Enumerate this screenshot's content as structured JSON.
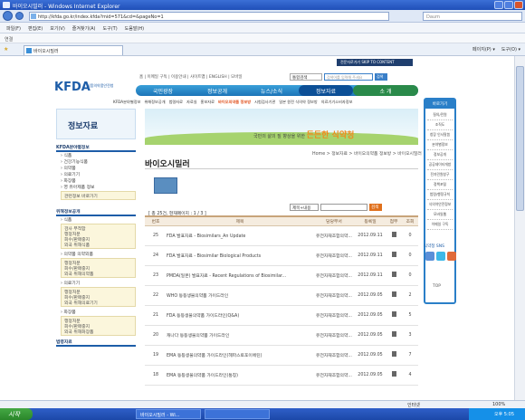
{
  "window": {
    "title": "바이오시밀러 - Windows Internet Explorer"
  },
  "browser": {
    "url": "http://kfda.go.kr/index.kfda?mid=571&cd=&pageNo=1",
    "web_search_placeholder": "Daum",
    "menu": [
      "파일(F)",
      "편집(E)",
      "보기(V)",
      "즐겨찾기(A)",
      "도구(T)",
      "도움말(H)"
    ],
    "links_label": "연결",
    "tab_label": "바이오시밀러",
    "tools": [
      "페이지(P) ▾",
      "도구(O) ▾"
    ],
    "status_text": "",
    "status_zone": "인터넷",
    "zoom": "100%"
  },
  "taskbar": {
    "start": "시작",
    "buttons": [
      "바이오시밀러 - Wi...",
      ""
    ],
    "clock": "오후 5:05"
  },
  "site": {
    "top_link": "전문자로가기 SKIP TO CONTENT",
    "logo": "KFDA",
    "logo_sub": "식품의약품안전청",
    "util_nav": "홈 | 이메일 구독 | 이용안내 | 사이트맵 | ENGLISH | 모바일",
    "search_select": "통합검색",
    "search_placeholder": "검색어를 입력해 주세요",
    "search_button": "검색",
    "gnb": [
      "국민광장",
      "정보공개",
      "뉴스/소식",
      "정보자료",
      "소 개"
    ],
    "subnav": {
      "items": [
        "KFDA분야별정보",
        "위해정보공개",
        "법령자료",
        "자료실",
        "홍보자료"
      ],
      "highlight": "바이오의약품 정보방",
      "rest": [
        "시험검사기관",
        "일본 원전 식의약 정보방",
        "의료기기소비자정보"
      ]
    },
    "banner_text": "국민의 삶의 질 향상을 위한",
    "banner_slogan": "든든한 식약청",
    "left_title": "정보자료",
    "left_nav": [
      {
        "title": "KFDA분야별정보",
        "items": [
          "식품",
          "건강기능식품",
          "의약품",
          "의료기기",
          "화장품",
          "영 유아제품 정보"
        ],
        "box": [
          "관련정보 바로가기"
        ]
      },
      {
        "title": "위해정보공개",
        "items": [
          "식품"
        ],
        "box": [
          "검사 부적합",
          "행정처분",
          "회수/판매중지",
          "외국 위해식품"
        ]
      },
      {
        "title": "",
        "items": [
          "의약품 의약외품"
        ],
        "box": [
          "행정처분",
          "회수/판매중지",
          "외국 위해의약품"
        ]
      },
      {
        "title": "",
        "items": [
          "의료기기"
        ],
        "box": [
          "행정처분",
          "회수/판매중지",
          "외국 위해의료기기"
        ]
      },
      {
        "title": "",
        "items": [
          "화장품"
        ],
        "box": [
          "행정처분",
          "회수/판매중지",
          "외국 위해화장품"
        ]
      },
      {
        "title": "법령자료",
        "items": [],
        "box": []
      }
    ],
    "quick_title": "바로가기",
    "quick_items": [
      "질의/민원",
      "조직도",
      "청장 인사말씀",
      "분야별정보",
      "정보공개",
      "공공데이터개방",
      "전자민원창구",
      "정책포털",
      "법령/행정규칙",
      "식의약안전정보",
      "모바일웹",
      "이메일 구독"
    ],
    "sns_title": "식약청 SNS",
    "top_button": "TOP"
  },
  "content": {
    "title": "바이오시밀러",
    "breadcrumb": "Home > 정보자료 > 바이오의약품 정보방 > 바이오시밀러",
    "search_select": "제목+내용",
    "search_button": "검색",
    "count": "[ 총 25건, 현재페이지 : 1 / 3 ]",
    "headers": [
      "번호",
      "제목",
      "담당부서",
      "등록일",
      "첨부",
      "조회"
    ],
    "rows": [
      {
        "no": "25",
        "title": "FDA 발표자료 - Biosimilars_An Update",
        "dept": "유전자재조합의약...",
        "date": "2012.09.11",
        "views": "0"
      },
      {
        "no": "24",
        "title": "FDA 발표자료 - Biosimilar Biological Products",
        "dept": "유전자재조합의약...",
        "date": "2012.09.11",
        "views": "0"
      },
      {
        "no": "23",
        "title": "PMDA(일본) 발표자료 - Recent Regulations of Biosimilar...",
        "dept": "유전자재조합의약...",
        "date": "2012.09.11",
        "views": "0"
      },
      {
        "no": "22",
        "title": "WHO 동등생물의약품 가이드라인",
        "dept": "유전자재조합의약...",
        "date": "2012.09.05",
        "views": "2"
      },
      {
        "no": "21",
        "title": "FDA 동등생물의약품 가이드라인(Q&A)",
        "dept": "유전자재조합의약...",
        "date": "2012.09.05",
        "views": "5"
      },
      {
        "no": "20",
        "title": "캐나다 동등생물의약품 가이드라인",
        "dept": "유전자재조합의약...",
        "date": "2012.09.05",
        "views": "3"
      },
      {
        "no": "19",
        "title": "EMA 동등생물의약품 가이드라인(헤파스토포이에틴)",
        "dept": "유전자재조합의약...",
        "date": "2012.09.05",
        "views": "7"
      },
      {
        "no": "18",
        "title": "EMA 동등생물의약품 가이드라인(통칭)",
        "dept": "유전자재조합의약...",
        "date": "2012.09.05",
        "views": "4"
      }
    ]
  }
}
